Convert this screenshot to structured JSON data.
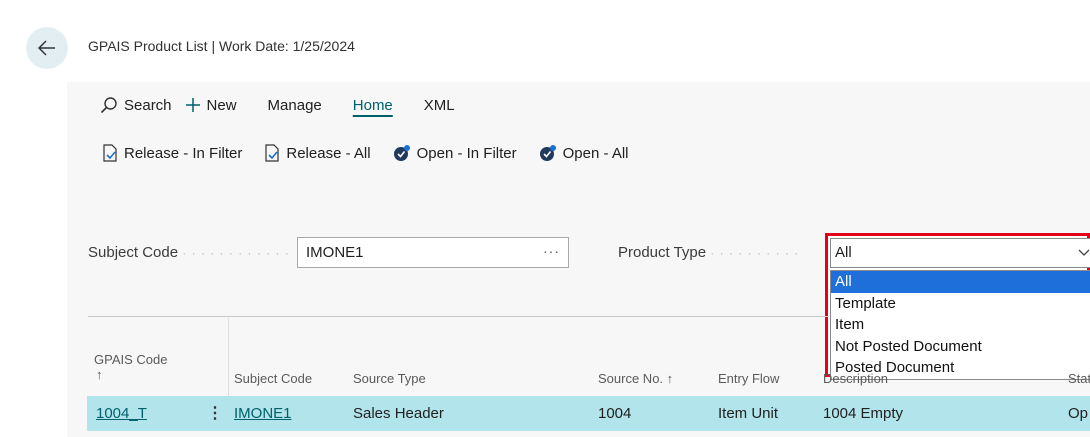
{
  "header": {
    "title": "GPAIS Product List | Work Date: 1/25/2024"
  },
  "actions": {
    "search": "Search",
    "new": "New",
    "manage": "Manage",
    "home": "Home",
    "xml": "XML"
  },
  "promoted": {
    "release_filter": "Release - In Filter",
    "release_all": "Release - All",
    "open_filter": "Open - In Filter",
    "open_all": "Open - All"
  },
  "filters": {
    "subject_code_label": "Subject Code",
    "subject_code_value": "IMONE1",
    "product_type_label": "Product Type",
    "product_type_value": "All",
    "product_type_options": [
      "All",
      "Template",
      "Item",
      "Not Posted Document",
      "Posted Document"
    ]
  },
  "table": {
    "headers": {
      "gpais_code": "GPAIS Code",
      "gpais_sort": "↑",
      "subject_code": "Subject Code",
      "source_type": "Source Type",
      "source_no": "Source No. ↑",
      "entry_flow": "Entry Flow",
      "description": "Description",
      "status": "Stat"
    },
    "rows": [
      {
        "gpais_code": "1004_T",
        "subject_code": "IMONE1",
        "source_type": "Sales Header",
        "source_no": "1004",
        "entry_flow": "Item Unit",
        "description": "1004 Empty",
        "status": "Op"
      }
    ]
  },
  "colors": {
    "accent": "#00606b",
    "selected_row": "#b2e5eb",
    "highlight": "#e2001a",
    "option_selected": "#1e6fd9"
  }
}
